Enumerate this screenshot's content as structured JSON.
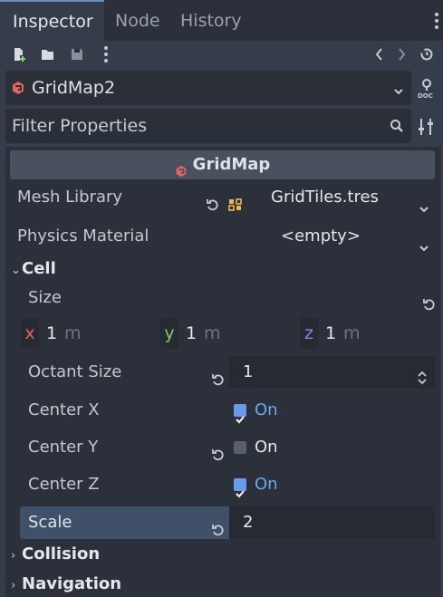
{
  "tabs": [
    {
      "label": "Inspector",
      "active": true
    },
    {
      "label": "Node",
      "active": false
    },
    {
      "label": "History",
      "active": false
    }
  ],
  "toolbar": {
    "icons": [
      "new-resource-icon",
      "load-resource-icon",
      "save-resource-icon",
      "more-options-icon",
      "history-back-icon",
      "history-forward-icon",
      "object-history-icon"
    ]
  },
  "object": {
    "name": "GridMap2",
    "icon": "gridmap-node-icon"
  },
  "filter": {
    "placeholder": "Filter Properties"
  },
  "class_header": {
    "name": "GridMap"
  },
  "properties": {
    "mesh_library": {
      "label": "Mesh Library",
      "value": "GridTiles.tres"
    },
    "physics_material": {
      "label": "Physics Material",
      "value": "<empty>"
    }
  },
  "cell": {
    "section": "Cell",
    "size": {
      "label": "Size",
      "x_label": "x",
      "x": "1",
      "y_label": "y",
      "y": "1",
      "z_label": "z",
      "z": "1",
      "unit": "m"
    },
    "octant_size": {
      "label": "Octant Size",
      "value": "1"
    },
    "center_x": {
      "label": "Center X",
      "value": "On",
      "checked": true
    },
    "center_y": {
      "label": "Center Y",
      "value": "On",
      "checked": false
    },
    "center_z": {
      "label": "Center Z",
      "value": "On",
      "checked": true
    },
    "scale": {
      "label": "Scale",
      "value": "2"
    }
  },
  "sections": {
    "collision": "Collision",
    "navigation": "Navigation"
  },
  "colors": {
    "accent": "#699ce8",
    "node_icon": "#e0675f",
    "x_axis": "#e0675f",
    "y_axis": "#8bc36c",
    "z_axis": "#9a7fe0",
    "background": "#363d4a"
  }
}
